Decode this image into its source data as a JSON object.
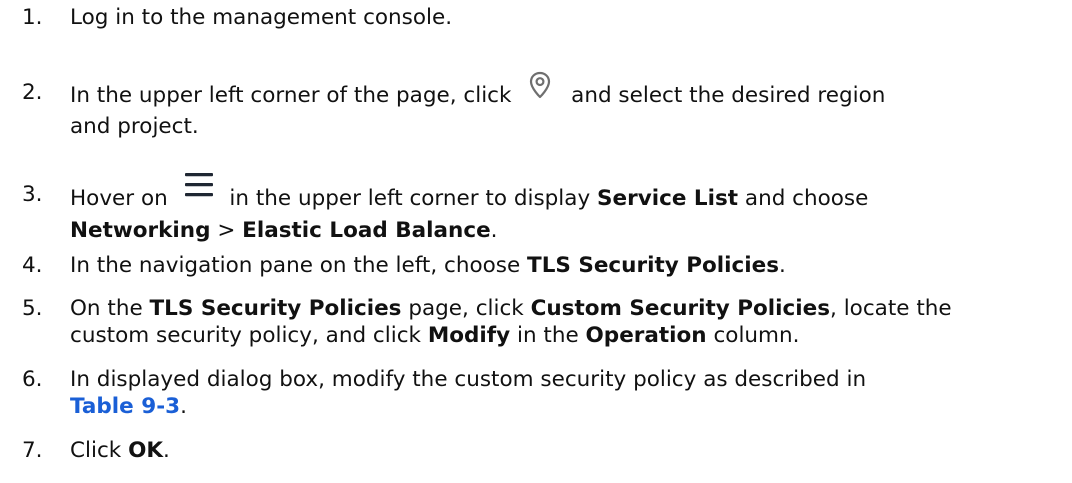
{
  "steps": [
    {
      "num": "1.",
      "parts": [
        "Log in to the management console."
      ]
    },
    {
      "num": "2.",
      "parts": [
        "In the upper left corner of the page, click",
        "and select the desired region",
        "and project."
      ],
      "icon": "location-pin-icon"
    },
    {
      "num": "3.",
      "parts": [
        "Hover on",
        "in the upper left corner to display",
        "Service List",
        "and choose",
        "Networking",
        ">",
        "Elastic Load Balance",
        "."
      ],
      "icon": "hamburger-menu-icon"
    },
    {
      "num": "4.",
      "parts": [
        "In the navigation pane on the left, choose",
        "TLS Security Policies",
        "."
      ]
    },
    {
      "num": "5.",
      "parts": [
        "On the",
        "TLS Security Policies",
        "page, click",
        "Custom Security Policies",
        ", locate the",
        "custom security policy, and click",
        "Modify",
        "in the",
        "Operation",
        "column."
      ]
    },
    {
      "num": "6.",
      "parts": [
        "In displayed dialog box, modify the custom security policy as described in",
        "Table 9-3",
        "."
      ]
    },
    {
      "num": "7.",
      "parts": [
        "Click",
        "OK",
        "."
      ]
    }
  ],
  "colors": {
    "text": "#111111",
    "link": "#1a5fd6",
    "icon": "#6f6f6f",
    "menu_icon": "#1f2733"
  }
}
